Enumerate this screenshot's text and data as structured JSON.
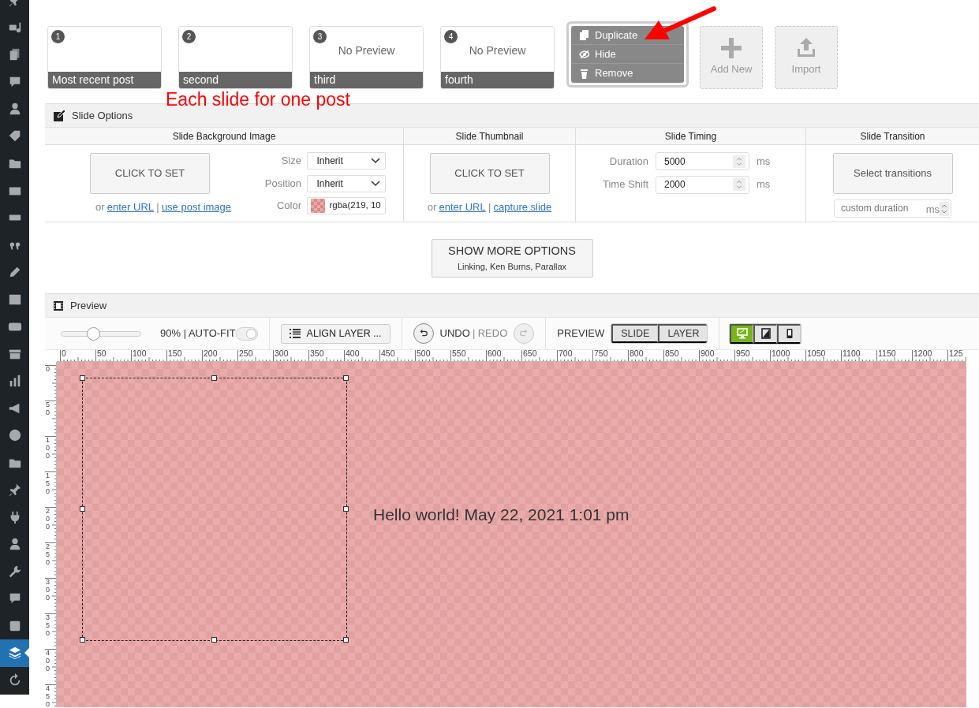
{
  "sidebar": {
    "items": [
      {
        "kind": "pin",
        "selected": false
      },
      {
        "kind": "media",
        "selected": false
      },
      {
        "kind": "pages",
        "selected": false
      },
      {
        "kind": "bubble",
        "selected": false
      },
      {
        "kind": "person",
        "selected": false
      },
      {
        "kind": "tag",
        "selected": false
      },
      {
        "kind": "folder",
        "selected": false
      },
      {
        "kind": "mail",
        "selected": false
      },
      {
        "kind": "ticket",
        "selected": false
      },
      {
        "kind": "quote",
        "selected": false
      },
      {
        "kind": "pencil",
        "selected": false
      },
      {
        "kind": "table",
        "selected": false
      },
      {
        "kind": "badge",
        "selected": false
      },
      {
        "kind": "box",
        "selected": false
      },
      {
        "kind": "chart",
        "selected": false
      },
      {
        "kind": "megaphone",
        "selected": false
      },
      {
        "kind": "circle",
        "selected": false
      },
      {
        "kind": "folder",
        "selected": false
      },
      {
        "kind": "pin",
        "selected": false
      },
      {
        "kind": "plug",
        "selected": false
      },
      {
        "kind": "person",
        "selected": false
      },
      {
        "kind": "wrench",
        "selected": false
      },
      {
        "kind": "bubble",
        "selected": false
      },
      {
        "kind": "square",
        "selected": false
      },
      {
        "kind": "layers",
        "selected": true
      },
      {
        "kind": "refresh",
        "selected": false
      }
    ]
  },
  "slides": [
    {
      "number": "1",
      "title": "Most recent post"
    },
    {
      "number": "2",
      "title": "second"
    },
    {
      "number": "3",
      "title": "third",
      "preview_text": "No Preview"
    },
    {
      "number": "4",
      "title": "fourth",
      "preview_text": "No Preview"
    }
  ],
  "slide_menu": {
    "items": [
      {
        "kind": "duplicate",
        "label": "Duplicate"
      },
      {
        "kind": "hide",
        "label": "Hide"
      },
      {
        "kind": "remove",
        "label": "Remove"
      }
    ]
  },
  "add_buttons": [
    {
      "kind": "add",
      "label": "Add New"
    },
    {
      "kind": "import",
      "label": "Import"
    }
  ],
  "annotation": {
    "caption": "Each slide for one post"
  },
  "slide_options": {
    "title": "Slide Options",
    "background": {
      "heading": "Slide Background Image",
      "button": "CLICK TO SET",
      "or": "or",
      "divider": "|",
      "links": [
        "enter URL",
        "use post image"
      ],
      "fields": [
        {
          "kind": "select",
          "label": "Size",
          "value": "Inherit"
        },
        {
          "kind": "select",
          "label": "Position",
          "value": "Inherit"
        },
        {
          "kind": "color",
          "label": "Color",
          "value": "rgba(219, 10"
        }
      ]
    },
    "thumbnail": {
      "heading": "Slide Thumbnail",
      "button": "CLICK TO SET",
      "or": "or",
      "divider": "|",
      "links": [
        "enter URL",
        "capture slide"
      ]
    },
    "timing": {
      "heading": "Slide Timing",
      "fields": [
        {
          "label": "Duration",
          "value": "5000",
          "unit": "ms"
        },
        {
          "label": "Time Shift",
          "value": "2000",
          "unit": "ms"
        }
      ]
    },
    "transition": {
      "heading": "Slide Transition",
      "button": "Select transitions",
      "custom": {
        "placeholder": "custom duration",
        "unit": "ms"
      }
    },
    "more_options": {
      "title": "SHOW MORE OPTIONS",
      "subtitle": "Linking, Ken Burns, Parallax"
    }
  },
  "preview": {
    "title": "Preview",
    "toolbar": {
      "zoom": {
        "level": 0.4
      },
      "zoom_label": "90% | AUTO-FIT",
      "auto_fit": true,
      "align_button": "ALIGN LAYER ...",
      "undo": "UNDO",
      "divider": "|",
      "redo": "REDO",
      "redo_disabled": true,
      "preview_label": "PREVIEW",
      "modes": [
        {
          "label": "SLIDE",
          "selected": false
        },
        {
          "label": "LAYER",
          "selected": false
        }
      ],
      "devices": [
        {
          "kind": "desktop",
          "selected": true
        },
        {
          "kind": "tablet",
          "selected": false
        },
        {
          "kind": "phone",
          "selected": false
        }
      ]
    },
    "ruler": {
      "x_labels": [
        "0",
        "50",
        "100",
        "150",
        "200",
        "250",
        "300",
        "350",
        "400",
        "450",
        "500",
        "550",
        "600",
        "650",
        "700",
        "750",
        "800",
        "850",
        "900",
        "950",
        "1000",
        "1050",
        "1100",
        "1150",
        "1200",
        "125"
      ],
      "y_labels": [
        "0",
        "50",
        "100",
        "150",
        "200",
        "250",
        "300",
        "350",
        "400",
        "450"
      ]
    },
    "canvas": {
      "layers": [
        {
          "kind": "shape",
          "selected": true
        },
        {
          "kind": "text",
          "text": "Hello world! May 22, 2021 1:01 pm",
          "selected": false
        }
      ]
    }
  }
}
